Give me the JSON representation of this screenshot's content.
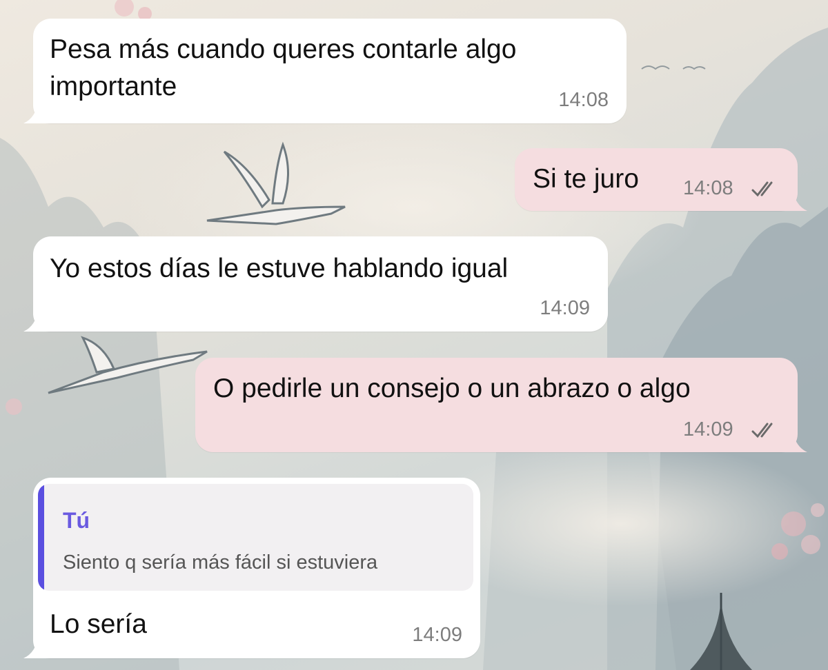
{
  "colors": {
    "incoming_bubble": "#ffffff",
    "outgoing_bubble": "#f5dde0",
    "quote_accent": "#5b4fe0",
    "quote_author": "#6a5ae0",
    "time_text": "#7d7d7d"
  },
  "messages": [
    {
      "direction": "incoming",
      "text_line1": "Pesa más cuando queres contarle algo",
      "text_line2": "importante",
      "time": "14:08"
    },
    {
      "direction": "outgoing",
      "text": "Si te juro",
      "time": "14:08",
      "status_icon": "double-check-icon"
    },
    {
      "direction": "incoming",
      "text": "Yo estos días le estuve hablando igual",
      "time": "14:09"
    },
    {
      "direction": "outgoing",
      "text": "O pedirle un consejo o un abrazo o algo",
      "time": "14:09",
      "status_icon": "double-check-icon"
    },
    {
      "direction": "incoming",
      "reply_to": {
        "author": "Tú",
        "text": "Siento q sería más fácil si estuviera"
      },
      "text": "Lo sería",
      "time": "14:09"
    }
  ]
}
